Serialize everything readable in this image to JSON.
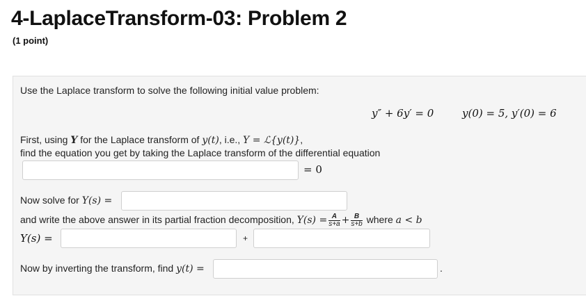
{
  "header": {
    "title": "4-LaplaceTransform-03: Problem 2",
    "points": "(1 point)"
  },
  "problem": {
    "intro": "Use the Laplace transform to solve the following initial value problem:",
    "ode": "y″ + 6y′ = 0",
    "initial_conditions": "y(0) = 5,  y′(0) = 6"
  },
  "step1": {
    "line1_text": "First, using ",
    "line1_var": "Y",
    "line1_mid": " for the Laplace transform of ",
    "line1_fn": "y(t)",
    "line1_ie": ", i.e., ",
    "line1_def": "Y = ℒ{y(t)}",
    "line1_end": ",",
    "line2": "find the equation you get by taking the Laplace transform of the differential equation",
    "input_value": "",
    "equals_zero": "= 0"
  },
  "step2": {
    "label_text": "Now solve for ",
    "label_math": "Y(s) =",
    "input_value": ""
  },
  "step3": {
    "text": "and write the above answer in its partial fraction decomposition, ",
    "lhs": "Y(s) =",
    "frac1_num": "A",
    "frac1_den": "s+a",
    "plus": "+",
    "frac2_num": "B",
    "frac2_den": "s+b",
    "where_text": " where ",
    "condition": "a < b",
    "row_label": "Y(s) =",
    "input_a_value": "",
    "plus_label": "+",
    "input_b_value": ""
  },
  "step4": {
    "text": "Now by inverting the transform, find ",
    "math": "y(t) =",
    "input_value": "",
    "trailing": "."
  }
}
